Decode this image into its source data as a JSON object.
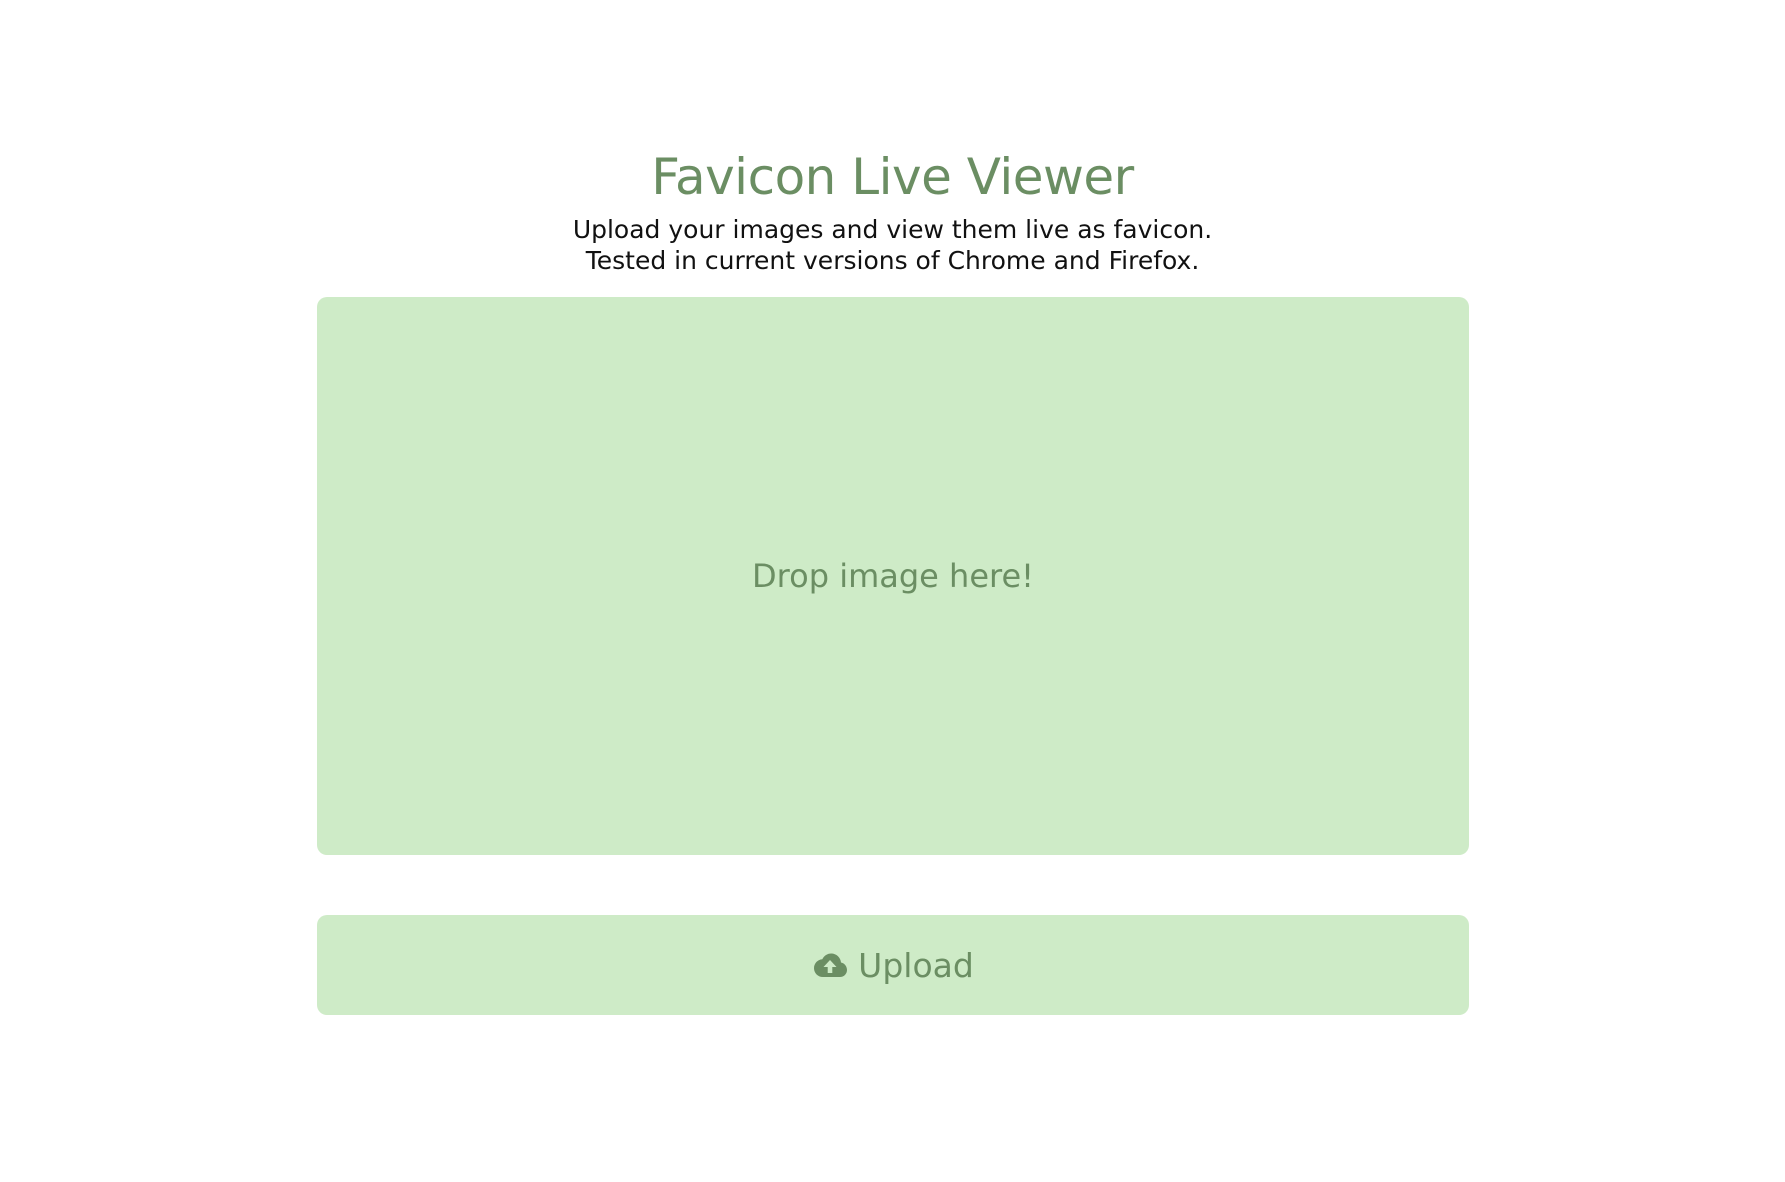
{
  "header": {
    "title": "Favicon Live Viewer",
    "subtitle_line1": "Upload your images and view them live as favicon.",
    "subtitle_line2": "Tested in current versions of Chrome and Firefox."
  },
  "dropzone": {
    "label": "Drop image here!"
  },
  "upload": {
    "label": "Upload",
    "icon": "cloud-upload-icon"
  },
  "colors": {
    "accent": "#6b8e63",
    "panel": "#ceebc7",
    "text": "#111111",
    "background": "#ffffff"
  }
}
